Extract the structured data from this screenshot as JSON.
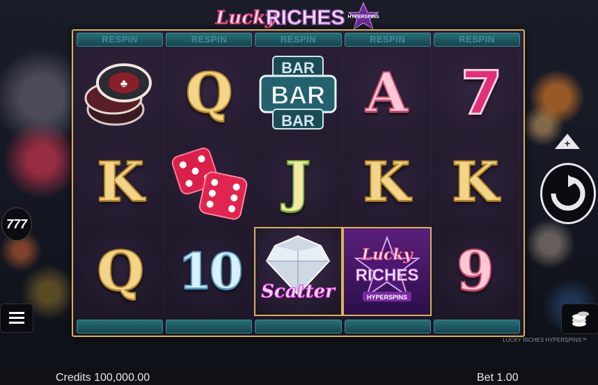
{
  "logo": {
    "lucky": "Lucky",
    "riches": "RICHES",
    "badge": "HYPERSPINS"
  },
  "respin_labels": [
    "RESPIN",
    "RESPIN",
    "RESPIN",
    "RESPIN",
    "RESPIN"
  ],
  "reels": {
    "row1": [
      "chips-icon",
      "Q",
      "BAR",
      "A",
      "7"
    ],
    "row2": [
      "K",
      "dice-icon",
      "J",
      "K",
      "K"
    ],
    "row3": [
      "Q",
      "10",
      "Scatter",
      "Lucky Riches",
      "9"
    ]
  },
  "scatter_label": "Scatter",
  "wild_label": {
    "line1": "Lucky",
    "line2": "RICHES",
    "line3": "HYPERSPINS"
  },
  "bar_label": "BAR",
  "watermark": "LUCKY RICHES HYPERSPINS™",
  "credits": "Credits 100,000.00",
  "bet": "Bet 1.00",
  "autoplay_label": "777",
  "colors": {
    "frame": "#d8b25a",
    "respin": "#15454e",
    "seven": "#e0307a"
  }
}
